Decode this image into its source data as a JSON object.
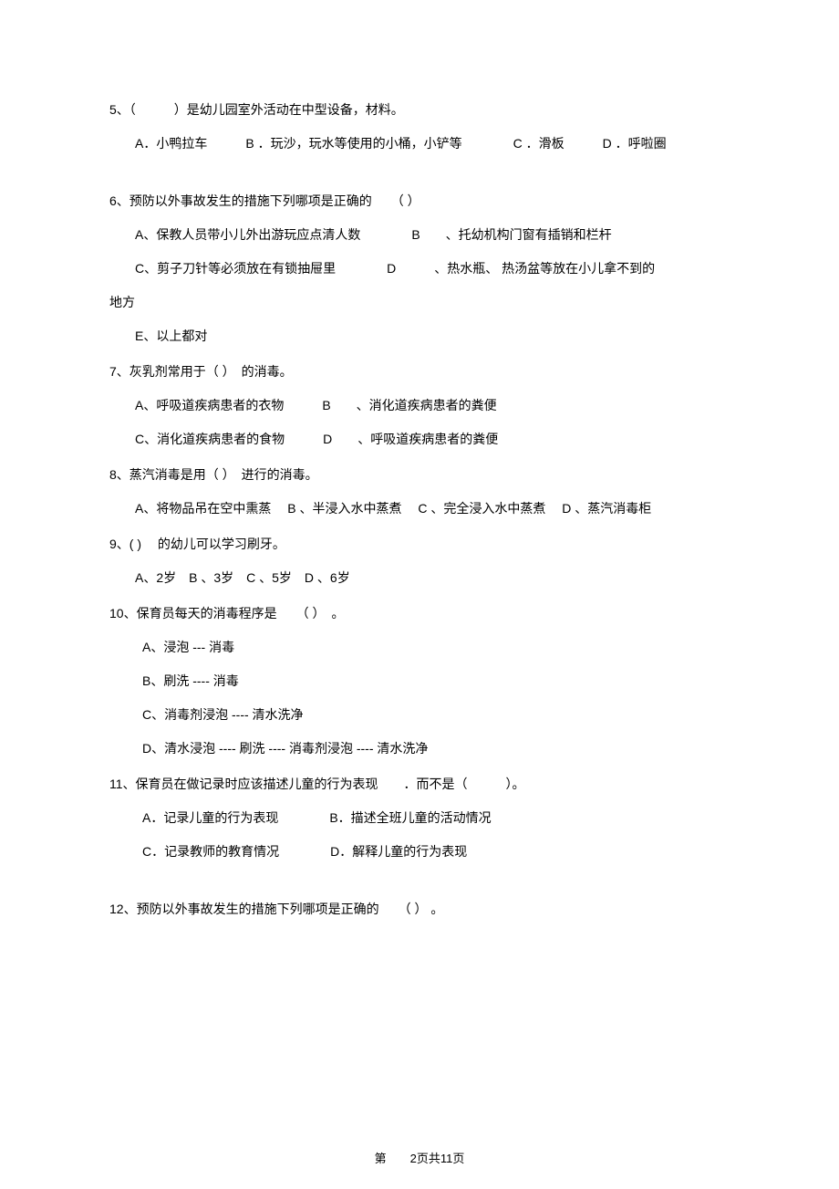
{
  "questions": {
    "q5": {
      "stem": "5、（　　　）是幼儿园室外活动在中型设备，材料。",
      "options": "A．小鸭拉车　　　B ．玩沙，玩水等使用的小桶，小铲等　　　　C ．滑板　　　D ．呼啦圈"
    },
    "q6": {
      "stem": "6、预防以外事故发生的措施下列哪项是正确的　　（  ）",
      "opt1": "A、保教人员带小儿外出游玩应点清人数　　　　B　　、托幼机构门窗有插销和栏杆",
      "opt2": "C、剪子刀针等必须放在有锁抽屉里　　　　D　　　、热水瓶、 热汤盆等放在小儿拿不到的",
      "cont": "地方",
      "opt3": "E、以上都对"
    },
    "q7": {
      "stem": "7、灰乳剂常用于（  ）　的消毒。",
      "opt1": "A、呼吸道疾病患者的衣物　　　B　　、消化道疾病患者的粪便",
      "opt2": "C、消化道疾病患者的食物　　　D　　、呼吸道疾病患者的粪便"
    },
    "q8": {
      "stem": "8、蒸汽消毒是用（  ）　进行的消毒。",
      "options": "A、将物品吊在空中熏蒸　 B 、半浸入水中蒸煮　 C 、完全浸入水中蒸煮　 D 、蒸汽消毒柜"
    },
    "q9": {
      "stem": "9、(  ) 　的幼儿可以学习刷牙。",
      "options": "A、2岁　B 、3岁　C 、5岁　D 、6岁"
    },
    "q10": {
      "stem": "10、保育员每天的消毒程序是　　（  ）　。",
      "optA": "A、浸泡 --- 消毒",
      "optB": "B、刷洗 ---- 消毒",
      "optC": "C、消毒剂浸泡 ---- 清水洗净",
      "optD": "D、清水浸泡 ---- 刷洗 ---- 消毒剂浸泡  ---- 清水洗净"
    },
    "q11": {
      "stem": "11、保育员在做记录时应该描述儿童的行为表现　　．而不是（　　　）。",
      "opt1": "A．记录儿童的行为表现　　　　B．描述全班儿童的活动情况",
      "opt2": "C．记录教师的教育情况　　　　D．解释儿童的行为表现"
    },
    "q12": {
      "stem": "12、预防以外事故发生的措施下列哪项是正确的　　（  ） 。"
    }
  },
  "footer": "第　　2页共11页"
}
